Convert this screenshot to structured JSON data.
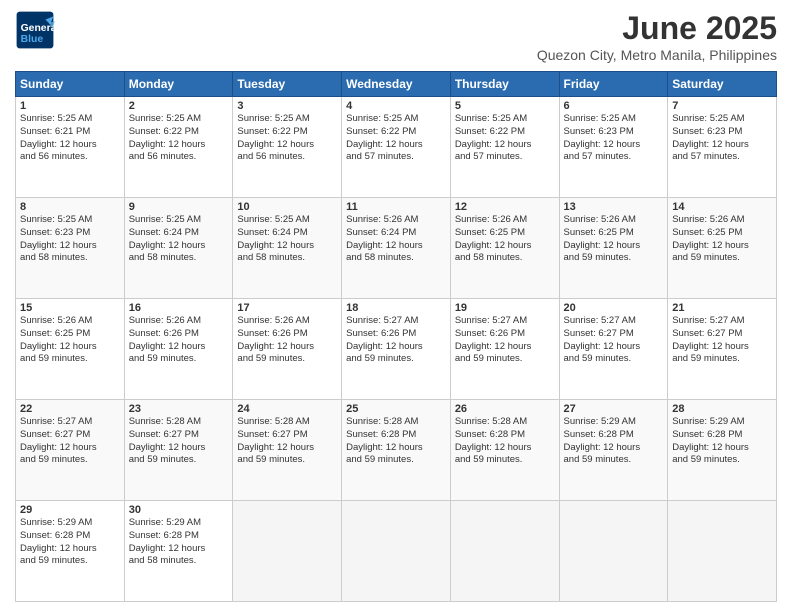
{
  "header": {
    "logo_general": "General",
    "logo_blue": "Blue",
    "month_title": "June 2025",
    "location": "Quezon City, Metro Manila, Philippines"
  },
  "weekdays": [
    "Sunday",
    "Monday",
    "Tuesday",
    "Wednesday",
    "Thursday",
    "Friday",
    "Saturday"
  ],
  "weeks": [
    [
      {
        "day": "1",
        "sunrise": "5:25 AM",
        "sunset": "6:21 PM",
        "daylight": "12 hours and 56 minutes."
      },
      {
        "day": "2",
        "sunrise": "5:25 AM",
        "sunset": "6:22 PM",
        "daylight": "12 hours and 56 minutes."
      },
      {
        "day": "3",
        "sunrise": "5:25 AM",
        "sunset": "6:22 PM",
        "daylight": "12 hours and 56 minutes."
      },
      {
        "day": "4",
        "sunrise": "5:25 AM",
        "sunset": "6:22 PM",
        "daylight": "12 hours and 57 minutes."
      },
      {
        "day": "5",
        "sunrise": "5:25 AM",
        "sunset": "6:22 PM",
        "daylight": "12 hours and 57 minutes."
      },
      {
        "day": "6",
        "sunrise": "5:25 AM",
        "sunset": "6:23 PM",
        "daylight": "12 hours and 57 minutes."
      },
      {
        "day": "7",
        "sunrise": "5:25 AM",
        "sunset": "6:23 PM",
        "daylight": "12 hours and 57 minutes."
      }
    ],
    [
      {
        "day": "8",
        "sunrise": "5:25 AM",
        "sunset": "6:23 PM",
        "daylight": "12 hours and 58 minutes."
      },
      {
        "day": "9",
        "sunrise": "5:25 AM",
        "sunset": "6:24 PM",
        "daylight": "12 hours and 58 minutes."
      },
      {
        "day": "10",
        "sunrise": "5:25 AM",
        "sunset": "6:24 PM",
        "daylight": "12 hours and 58 minutes."
      },
      {
        "day": "11",
        "sunrise": "5:26 AM",
        "sunset": "6:24 PM",
        "daylight": "12 hours and 58 minutes."
      },
      {
        "day": "12",
        "sunrise": "5:26 AM",
        "sunset": "6:25 PM",
        "daylight": "12 hours and 58 minutes."
      },
      {
        "day": "13",
        "sunrise": "5:26 AM",
        "sunset": "6:25 PM",
        "daylight": "12 hours and 59 minutes."
      },
      {
        "day": "14",
        "sunrise": "5:26 AM",
        "sunset": "6:25 PM",
        "daylight": "12 hours and 59 minutes."
      }
    ],
    [
      {
        "day": "15",
        "sunrise": "5:26 AM",
        "sunset": "6:25 PM",
        "daylight": "12 hours and 59 minutes."
      },
      {
        "day": "16",
        "sunrise": "5:26 AM",
        "sunset": "6:26 PM",
        "daylight": "12 hours and 59 minutes."
      },
      {
        "day": "17",
        "sunrise": "5:26 AM",
        "sunset": "6:26 PM",
        "daylight": "12 hours and 59 minutes."
      },
      {
        "day": "18",
        "sunrise": "5:27 AM",
        "sunset": "6:26 PM",
        "daylight": "12 hours and 59 minutes."
      },
      {
        "day": "19",
        "sunrise": "5:27 AM",
        "sunset": "6:26 PM",
        "daylight": "12 hours and 59 minutes."
      },
      {
        "day": "20",
        "sunrise": "5:27 AM",
        "sunset": "6:27 PM",
        "daylight": "12 hours and 59 minutes."
      },
      {
        "day": "21",
        "sunrise": "5:27 AM",
        "sunset": "6:27 PM",
        "daylight": "12 hours and 59 minutes."
      }
    ],
    [
      {
        "day": "22",
        "sunrise": "5:27 AM",
        "sunset": "6:27 PM",
        "daylight": "12 hours and 59 minutes."
      },
      {
        "day": "23",
        "sunrise": "5:28 AM",
        "sunset": "6:27 PM",
        "daylight": "12 hours and 59 minutes."
      },
      {
        "day": "24",
        "sunrise": "5:28 AM",
        "sunset": "6:27 PM",
        "daylight": "12 hours and 59 minutes."
      },
      {
        "day": "25",
        "sunrise": "5:28 AM",
        "sunset": "6:28 PM",
        "daylight": "12 hours and 59 minutes."
      },
      {
        "day": "26",
        "sunrise": "5:28 AM",
        "sunset": "6:28 PM",
        "daylight": "12 hours and 59 minutes."
      },
      {
        "day": "27",
        "sunrise": "5:29 AM",
        "sunset": "6:28 PM",
        "daylight": "12 hours and 59 minutes."
      },
      {
        "day": "28",
        "sunrise": "5:29 AM",
        "sunset": "6:28 PM",
        "daylight": "12 hours and 59 minutes."
      }
    ],
    [
      {
        "day": "29",
        "sunrise": "5:29 AM",
        "sunset": "6:28 PM",
        "daylight": "12 hours and 59 minutes."
      },
      {
        "day": "30",
        "sunrise": "5:29 AM",
        "sunset": "6:28 PM",
        "daylight": "12 hours and 58 minutes."
      },
      null,
      null,
      null,
      null,
      null
    ]
  ],
  "labels": {
    "sunrise": "Sunrise:",
    "sunset": "Sunset:",
    "daylight": "Daylight:"
  }
}
